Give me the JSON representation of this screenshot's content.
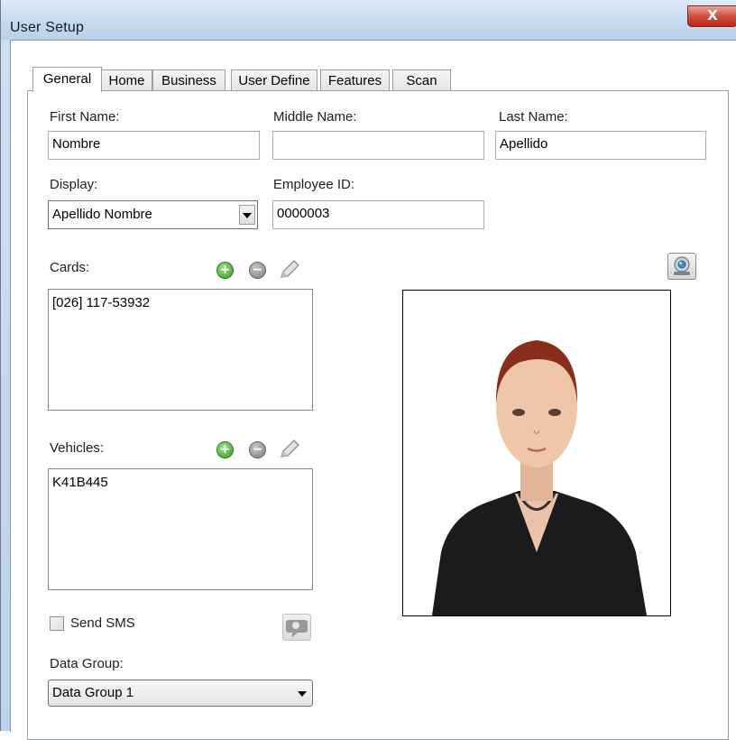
{
  "window": {
    "title": "User Setup",
    "close_glyph": "X"
  },
  "tabs": [
    {
      "label": "General",
      "active": true
    },
    {
      "label": "Home",
      "active": false
    },
    {
      "label": "Business",
      "active": false
    },
    {
      "label": "User Define",
      "active": false
    },
    {
      "label": "Features",
      "active": false
    },
    {
      "label": "Scan",
      "active": false
    }
  ],
  "form": {
    "first_name": {
      "label": "First Name:",
      "value": "Nombre"
    },
    "middle_name": {
      "label": "Middle Name:",
      "value": ""
    },
    "last_name": {
      "label": "Last Name:",
      "value": "Apellido"
    },
    "display": {
      "label": "Display:",
      "value": "Apellido Nombre"
    },
    "employee_id": {
      "label": "Employee ID:",
      "value": "0000003"
    }
  },
  "cards": {
    "label": "Cards:",
    "items": [
      "[026] 117-53932"
    ]
  },
  "vehicles": {
    "label": "Vehicles:",
    "items": [
      "K41B445"
    ]
  },
  "send_sms": {
    "label": "Send SMS",
    "checked": false
  },
  "data_group": {
    "label": "Data Group:",
    "value": "Data Group 1"
  },
  "icons": {
    "add": "add-icon",
    "remove": "remove-icon",
    "edit": "pencil-icon",
    "webcam": "webcam-icon",
    "sms": "sms-icon",
    "dropdown": "chevron-down-icon"
  },
  "colors": {
    "title_bar": "#c4d8ee",
    "close_button": "#c83a2b",
    "add_icon": "#3e9a2c",
    "photo_top": "#8a2e1c"
  }
}
